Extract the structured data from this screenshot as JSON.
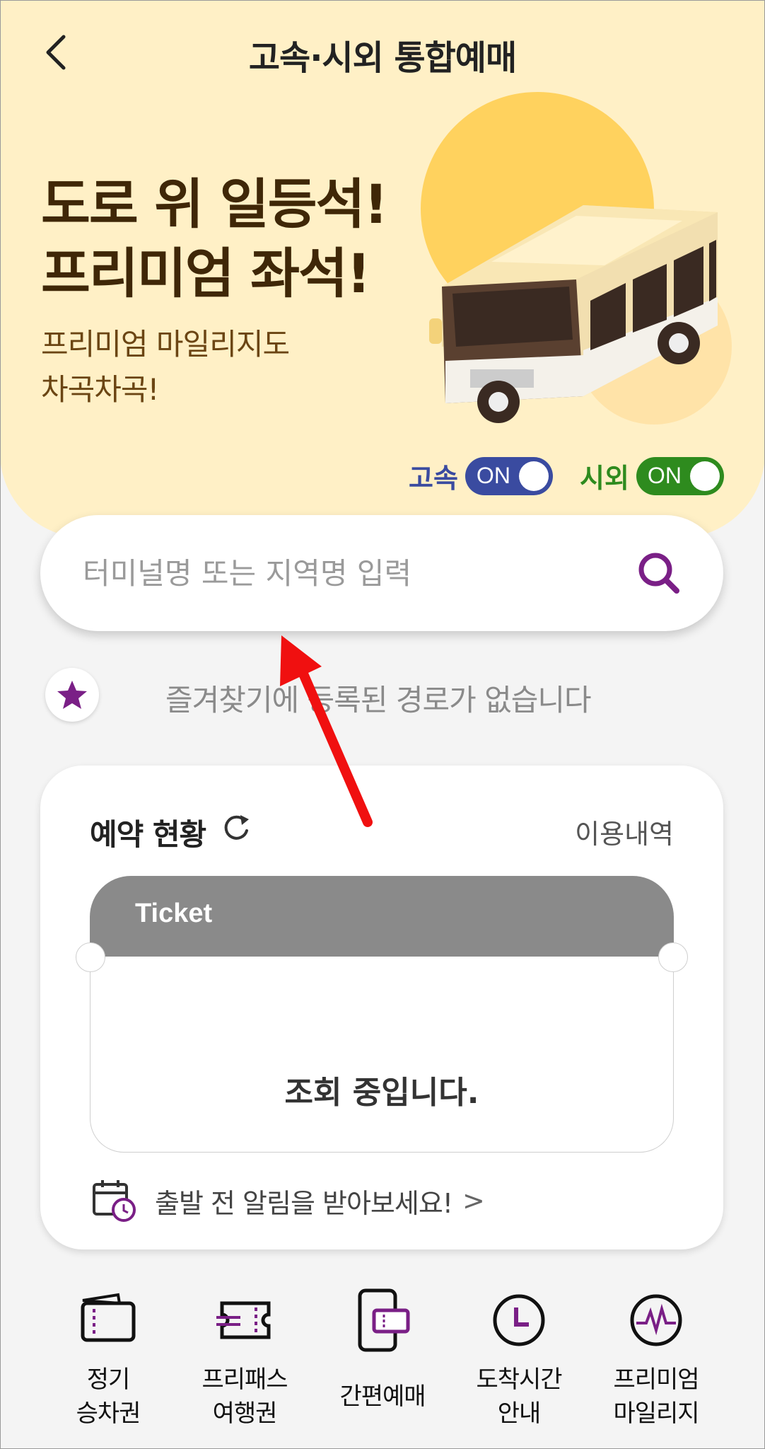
{
  "header": {
    "title": "고속·시외 통합예매",
    "back_icon": "chevron-left-icon"
  },
  "banner": {
    "headline_line1": "도로 위 일등석!",
    "headline_line2": "프리미엄 좌석!",
    "sub_line1": "프리미엄 마일리지도",
    "sub_line2": "차곡차곡!"
  },
  "toggles": {
    "express": {
      "label": "고속",
      "state": "ON",
      "color": "#3a4ba0"
    },
    "intercity": {
      "label": "시외",
      "state": "ON",
      "color": "#2e8b1e"
    }
  },
  "search": {
    "placeholder": "터미널명 또는 지역명 입력",
    "icon": "search-icon",
    "accent": "#7a1f86"
  },
  "favorites": {
    "empty_text": "즐겨찾기에 등록된 경로가 없습니다",
    "icon": "star-icon"
  },
  "reservation": {
    "title": "예약 현황",
    "history_link": "이용내역",
    "ticket_header": "Ticket",
    "ticket_status": "조회 중입니다.",
    "alert_text": "출발 전 알림을 받아보세요!",
    "alert_chevron": ">"
  },
  "menu": [
    {
      "label": "정기\n승차권",
      "icon": "pass-card-icon"
    },
    {
      "label": "프리패스\n여행권",
      "icon": "free-pass-ticket-icon"
    },
    {
      "label": "간편예매",
      "icon": "mobile-ticket-icon"
    },
    {
      "label": "도착시간\n안내",
      "icon": "clock-icon"
    },
    {
      "label": "프리미엄\n마일리지",
      "icon": "mileage-icon"
    }
  ],
  "colors": {
    "brand_purple": "#7a1f86",
    "hero_bg": "#fff0c6",
    "headline": "#3f2707",
    "arrow": "#f01010"
  }
}
